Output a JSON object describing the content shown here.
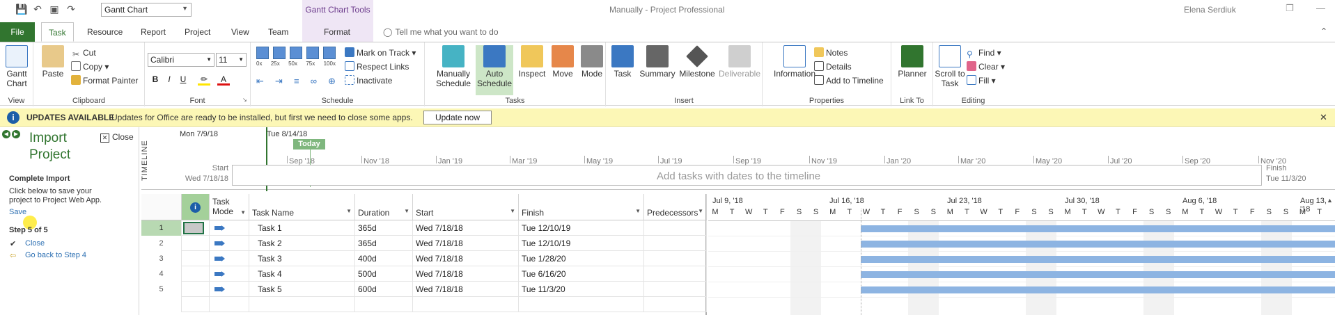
{
  "window": {
    "title": "Manually  -  Project Professional",
    "user": "Elena Serdiuk",
    "view_selector": "Gantt Chart",
    "context_tool_title": "Gantt Chart Tools"
  },
  "tabs": [
    {
      "label": "File"
    },
    {
      "label": "Task"
    },
    {
      "label": "Resource"
    },
    {
      "label": "Report"
    },
    {
      "label": "Project"
    },
    {
      "label": "View"
    },
    {
      "label": "Team"
    },
    {
      "label": "Format"
    }
  ],
  "tell_me": "Tell me what you want to do",
  "ribbon": {
    "view": {
      "label": "View",
      "gantt": "Gantt Chart"
    },
    "clipboard": {
      "label": "Clipboard",
      "paste": "Paste",
      "cut": "Cut",
      "copy": "Copy",
      "format_painter": "Format Painter"
    },
    "font": {
      "label": "Font",
      "name": "Calibri",
      "size": "11",
      "bold": "B",
      "italic": "I",
      "underline": "U"
    },
    "schedule": {
      "label": "Schedule",
      "mark_on_track": "Mark on Track",
      "respect_links": "Respect Links",
      "inactivate": "Inactivate",
      "pct": [
        "0x",
        "25x",
        "50x",
        "75x",
        "100x"
      ]
    },
    "tasks": {
      "label": "Tasks",
      "manually": "Manually Schedule",
      "auto": "Auto Schedule",
      "inspect": "Inspect",
      "move": "Move",
      "mode": "Mode"
    },
    "insert": {
      "label": "Insert",
      "task": "Task",
      "summary": "Summary",
      "milestone": "Milestone",
      "deliverable": "Deliverable"
    },
    "properties": {
      "label": "Properties",
      "information": "Information",
      "notes": "Notes",
      "details": "Details",
      "add_to_timeline": "Add to Timeline"
    },
    "linkto": {
      "label": "Link To",
      "planner": "Planner"
    },
    "editing": {
      "label": "Editing",
      "scroll_to_task": "Scroll to Task",
      "find": "Find",
      "clear": "Clear",
      "fill": "Fill"
    }
  },
  "update_bar": {
    "title": "UPDATES AVAILABLE",
    "message": "Updates for Office are ready to be installed, but first we need to close some apps.",
    "button": "Update now"
  },
  "left_pane": {
    "title_line1": "Import",
    "title_line2": "Project",
    "close": "Close",
    "heading": "Complete Import",
    "description_line1": "Click below to save your",
    "description_line2": "project to Project Web App.",
    "save": "Save",
    "step": "Step 5 of 5",
    "close_link": "Close",
    "back_link": "Go back to Step 4"
  },
  "timeline": {
    "label": "TIMELINE",
    "start_date": "Mon 7/9/18",
    "today_date": "Tue 8/14/18",
    "today": "Today",
    "start_label": "Start",
    "start_value": "Wed 7/18/18",
    "finish_label": "Finish",
    "finish_value": "Tue 11/3/20",
    "placeholder": "Add tasks with dates to the timeline",
    "ticks": [
      "Sep '18",
      "Nov '18",
      "Jan '19",
      "Mar '19",
      "May '19",
      "Jul '19",
      "Sep '19",
      "Nov '19",
      "Jan '20",
      "Mar '20",
      "May '20",
      "Jul '20",
      "Sep '20",
      "Nov '20"
    ]
  },
  "grid": {
    "headers": {
      "mode": "Task Mode",
      "mode1": "Task",
      "mode2": "Mode",
      "name": "Task Name",
      "duration": "Duration",
      "start": "Start",
      "finish": "Finish",
      "predecessors": "Predecessors"
    },
    "rows": [
      {
        "id": "1",
        "name": "Task 1",
        "duration": "365d",
        "start": "Wed 7/18/18",
        "finish": "Tue 12/10/19",
        "pred": ""
      },
      {
        "id": "2",
        "name": "Task 2",
        "duration": "365d",
        "start": "Wed 7/18/18",
        "finish": "Tue 12/10/19",
        "pred": ""
      },
      {
        "id": "3",
        "name": "Task 3",
        "duration": "400d",
        "start": "Wed 7/18/18",
        "finish": "Tue 1/28/20",
        "pred": ""
      },
      {
        "id": "4",
        "name": "Task 4",
        "duration": "500d",
        "start": "Wed 7/18/18",
        "finish": "Tue 6/16/20",
        "pred": ""
      },
      {
        "id": "5",
        "name": "Task 5",
        "duration": "600d",
        "start": "Wed 7/18/18",
        "finish": "Tue 11/3/20",
        "pred": ""
      }
    ]
  },
  "gantt": {
    "weeks": [
      "Jul 9, '18",
      "Jul 16, '18",
      "Jul 23, '18",
      "Jul 30, '18",
      "Aug 6, '18",
      "Aug 13, '18"
    ],
    "day_letters": [
      "M",
      "T",
      "W",
      "T",
      "F",
      "S",
      "S"
    ],
    "bar_color": "#8db4e2"
  }
}
